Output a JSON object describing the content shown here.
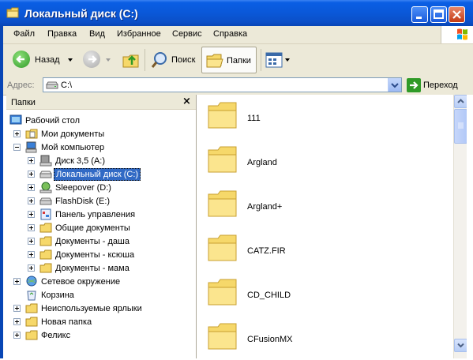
{
  "window": {
    "title": "Локальный диск (C:)",
    "titlebar_color": "#0a58d8"
  },
  "menu": [
    "Файл",
    "Правка",
    "Вид",
    "Избранное",
    "Сервис",
    "Справка"
  ],
  "toolbar": {
    "back_label": "Назад",
    "search_label": "Поиск",
    "folders_label": "Папки"
  },
  "address": {
    "label": "Адрес:",
    "value": "C:\\",
    "go_label": "Переход"
  },
  "folders_pane": {
    "title": "Папки",
    "close_glyph": "×",
    "items": [
      {
        "label": "Рабочий стол",
        "icon": "desktop-icon"
      },
      {
        "label": "Мои документы",
        "icon": "documents-folder-icon"
      },
      {
        "label": "Мой компьютер",
        "icon": "computer-icon"
      },
      {
        "label": "Диск 3,5 (A:)",
        "icon": "floppy-drive-icon"
      },
      {
        "label": "Локальный диск (C:)",
        "icon": "hard-drive-icon",
        "selected": true
      },
      {
        "label": "Sleepover (D:)",
        "icon": "cd-drive-icon"
      },
      {
        "label": "FlashDisk (E:)",
        "icon": "removable-drive-icon"
      },
      {
        "label": "Панель управления",
        "icon": "control-panel-icon"
      },
      {
        "label": "Общие документы",
        "icon": "folder-icon"
      },
      {
        "label": "Документы - даша",
        "icon": "folder-icon"
      },
      {
        "label": "Документы - ксюша",
        "icon": "folder-icon"
      },
      {
        "label": "Документы - мама",
        "icon": "folder-icon"
      },
      {
        "label": "Сетевое окружение",
        "icon": "network-icon"
      },
      {
        "label": "Корзина",
        "icon": "recycle-bin-icon"
      },
      {
        "label": "Неиспользуемые ярлыки",
        "icon": "folder-icon"
      },
      {
        "label": "Новая папка",
        "icon": "folder-icon"
      },
      {
        "label": "Феликс",
        "icon": "folder-icon"
      }
    ]
  },
  "files": [
    "111",
    "Argland",
    "Argland+",
    "CATZ.FIR",
    "CD_CHILD",
    "CFusionMX"
  ]
}
